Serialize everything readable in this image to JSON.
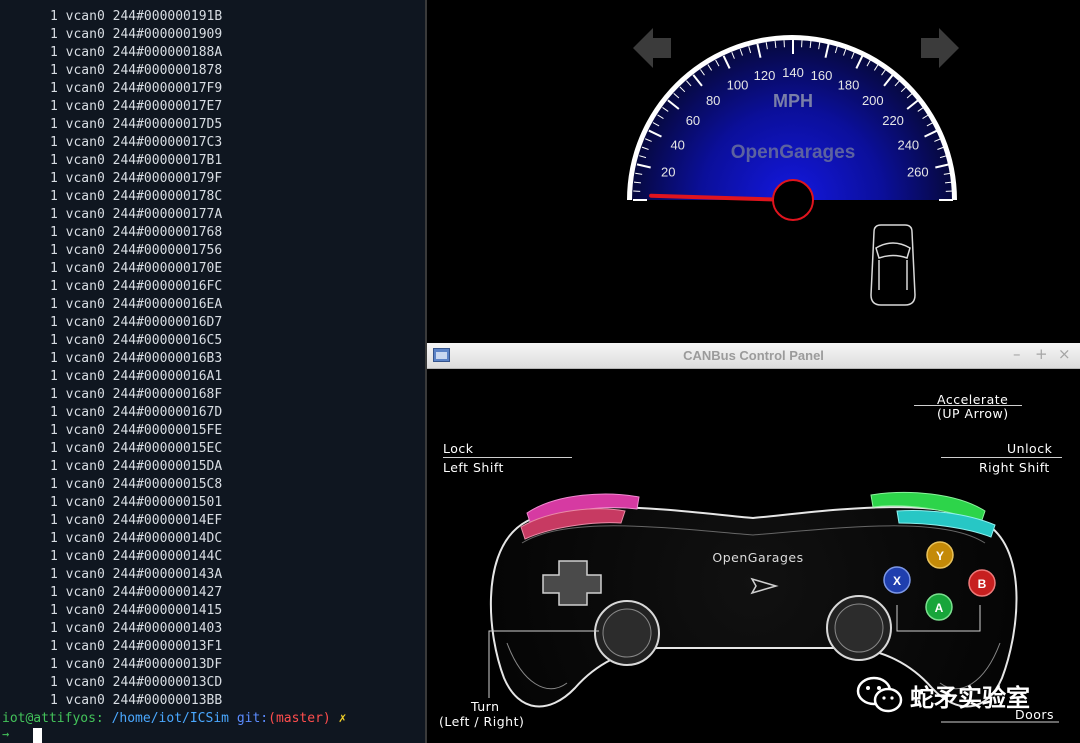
{
  "terminal": {
    "lines": [
      "1 vcan0 244#000000191B",
      "1 vcan0 244#0000001909",
      "1 vcan0 244#000000188A",
      "1 vcan0 244#0000001878",
      "1 vcan0 244#00000017F9",
      "1 vcan0 244#00000017E7",
      "1 vcan0 244#00000017D5",
      "1 vcan0 244#00000017C3",
      "1 vcan0 244#00000017B1",
      "1 vcan0 244#000000179F",
      "1 vcan0 244#000000178C",
      "1 vcan0 244#000000177A",
      "1 vcan0 244#0000001768",
      "1 vcan0 244#0000001756",
      "1 vcan0 244#000000170E",
      "1 vcan0 244#00000016FC",
      "1 vcan0 244#00000016EA",
      "1 vcan0 244#00000016D7",
      "1 vcan0 244#00000016C5",
      "1 vcan0 244#00000016B3",
      "1 vcan0 244#00000016A1",
      "1 vcan0 244#000000168F",
      "1 vcan0 244#000000167D",
      "1 vcan0 244#00000015FE",
      "1 vcan0 244#00000015EC",
      "1 vcan0 244#00000015DA",
      "1 vcan0 244#00000015C8",
      "1 vcan0 244#0000001501",
      "1 vcan0 244#00000014EF",
      "1 vcan0 244#00000014DC",
      "1 vcan0 244#000000144C",
      "1 vcan0 244#000000143A",
      "1 vcan0 244#0000001427",
      "1 vcan0 244#0000001415",
      "1 vcan0 244#0000001403",
      "1 vcan0 244#00000013F1",
      "1 vcan0 244#00000013DF",
      "1 vcan0 244#00000013CD",
      "1 vcan0 244#00000013BB"
    ],
    "prompt": {
      "user_host": "iot@attifyos:",
      "path": "/home/iot/ICSim",
      "git_label": "git:",
      "branch": "(master)",
      "dirty_mark": "✗",
      "arrow": "→"
    }
  },
  "instrument_cluster": {
    "unit": "MPH",
    "brand": "OpenGarages",
    "speed_ticks": [
      "20",
      "40",
      "60",
      "80",
      "100",
      "120",
      "140",
      "160",
      "180",
      "200",
      "220",
      "240",
      "260"
    ],
    "speed_value": 0,
    "left_turn_signal": "left-arrow-icon",
    "right_turn_signal": "right-arrow-icon",
    "car_icon": "car-top-icon"
  },
  "control_panel": {
    "window_title": "CANBus Control Panel",
    "buttons": {
      "minimize": "–",
      "maximize": "+",
      "close": "×"
    },
    "labels": {
      "accelerate": "Accelerate",
      "accelerate_key": "(UP Arrow)",
      "lock": "Lock",
      "lock_key": "Left Shift",
      "unlock": "Unlock",
      "unlock_key": "Right Shift",
      "controller_brand": "OpenGarages",
      "turn": "Turn",
      "turn_key": "(Left / Right)",
      "doors": "Doors"
    },
    "face_buttons": {
      "x": "X",
      "y": "Y",
      "a": "A",
      "b": "B"
    }
  },
  "watermark": {
    "text": "蛇矛实验室",
    "icon": "wechat-icon"
  },
  "colors": {
    "terminal_bg": "#0f1620",
    "gauge_blue": "#1418c8",
    "needle": "#e0141e",
    "btn_x": "#1f3fae",
    "btn_y": "#c48a08",
    "btn_a": "#17a53a",
    "btn_b": "#c71f1f"
  }
}
